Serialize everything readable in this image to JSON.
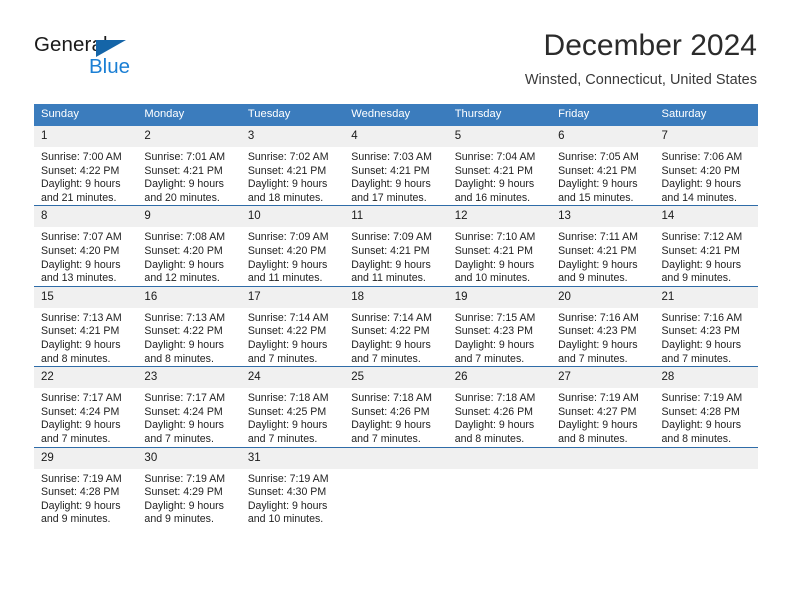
{
  "brand": {
    "name_part1": "General",
    "name_part2": "Blue",
    "accent_color": "#1b7fd4",
    "triangle_color": "#1565a8"
  },
  "header": {
    "title": "December 2024",
    "subtitle": "Winsted, Connecticut, United States"
  },
  "calendar": {
    "header_bg": "#3b7cbd",
    "daynum_bg": "#f0f0f0",
    "row_divider_color": "#2f6ca8",
    "weekday_headers": [
      "Sunday",
      "Monday",
      "Tuesday",
      "Wednesday",
      "Thursday",
      "Friday",
      "Saturday"
    ],
    "weeks": [
      [
        {
          "day": "1",
          "sunrise": "Sunrise: 7:00 AM",
          "sunset": "Sunset: 4:22 PM",
          "daylight1": "Daylight: 9 hours",
          "daylight2": "and 21 minutes."
        },
        {
          "day": "2",
          "sunrise": "Sunrise: 7:01 AM",
          "sunset": "Sunset: 4:21 PM",
          "daylight1": "Daylight: 9 hours",
          "daylight2": "and 20 minutes."
        },
        {
          "day": "3",
          "sunrise": "Sunrise: 7:02 AM",
          "sunset": "Sunset: 4:21 PM",
          "daylight1": "Daylight: 9 hours",
          "daylight2": "and 18 minutes."
        },
        {
          "day": "4",
          "sunrise": "Sunrise: 7:03 AM",
          "sunset": "Sunset: 4:21 PM",
          "daylight1": "Daylight: 9 hours",
          "daylight2": "and 17 minutes."
        },
        {
          "day": "5",
          "sunrise": "Sunrise: 7:04 AM",
          "sunset": "Sunset: 4:21 PM",
          "daylight1": "Daylight: 9 hours",
          "daylight2": "and 16 minutes."
        },
        {
          "day": "6",
          "sunrise": "Sunrise: 7:05 AM",
          "sunset": "Sunset: 4:21 PM",
          "daylight1": "Daylight: 9 hours",
          "daylight2": "and 15 minutes."
        },
        {
          "day": "7",
          "sunrise": "Sunrise: 7:06 AM",
          "sunset": "Sunset: 4:20 PM",
          "daylight1": "Daylight: 9 hours",
          "daylight2": "and 14 minutes."
        }
      ],
      [
        {
          "day": "8",
          "sunrise": "Sunrise: 7:07 AM",
          "sunset": "Sunset: 4:20 PM",
          "daylight1": "Daylight: 9 hours",
          "daylight2": "and 13 minutes."
        },
        {
          "day": "9",
          "sunrise": "Sunrise: 7:08 AM",
          "sunset": "Sunset: 4:20 PM",
          "daylight1": "Daylight: 9 hours",
          "daylight2": "and 12 minutes."
        },
        {
          "day": "10",
          "sunrise": "Sunrise: 7:09 AM",
          "sunset": "Sunset: 4:20 PM",
          "daylight1": "Daylight: 9 hours",
          "daylight2": "and 11 minutes."
        },
        {
          "day": "11",
          "sunrise": "Sunrise: 7:09 AM",
          "sunset": "Sunset: 4:21 PM",
          "daylight1": "Daylight: 9 hours",
          "daylight2": "and 11 minutes."
        },
        {
          "day": "12",
          "sunrise": "Sunrise: 7:10 AM",
          "sunset": "Sunset: 4:21 PM",
          "daylight1": "Daylight: 9 hours",
          "daylight2": "and 10 minutes."
        },
        {
          "day": "13",
          "sunrise": "Sunrise: 7:11 AM",
          "sunset": "Sunset: 4:21 PM",
          "daylight1": "Daylight: 9 hours",
          "daylight2": "and 9 minutes."
        },
        {
          "day": "14",
          "sunrise": "Sunrise: 7:12 AM",
          "sunset": "Sunset: 4:21 PM",
          "daylight1": "Daylight: 9 hours",
          "daylight2": "and 9 minutes."
        }
      ],
      [
        {
          "day": "15",
          "sunrise": "Sunrise: 7:13 AM",
          "sunset": "Sunset: 4:21 PM",
          "daylight1": "Daylight: 9 hours",
          "daylight2": "and 8 minutes."
        },
        {
          "day": "16",
          "sunrise": "Sunrise: 7:13 AM",
          "sunset": "Sunset: 4:22 PM",
          "daylight1": "Daylight: 9 hours",
          "daylight2": "and 8 minutes."
        },
        {
          "day": "17",
          "sunrise": "Sunrise: 7:14 AM",
          "sunset": "Sunset: 4:22 PM",
          "daylight1": "Daylight: 9 hours",
          "daylight2": "and 7 minutes."
        },
        {
          "day": "18",
          "sunrise": "Sunrise: 7:14 AM",
          "sunset": "Sunset: 4:22 PM",
          "daylight1": "Daylight: 9 hours",
          "daylight2": "and 7 minutes."
        },
        {
          "day": "19",
          "sunrise": "Sunrise: 7:15 AM",
          "sunset": "Sunset: 4:23 PM",
          "daylight1": "Daylight: 9 hours",
          "daylight2": "and 7 minutes."
        },
        {
          "day": "20",
          "sunrise": "Sunrise: 7:16 AM",
          "sunset": "Sunset: 4:23 PM",
          "daylight1": "Daylight: 9 hours",
          "daylight2": "and 7 minutes."
        },
        {
          "day": "21",
          "sunrise": "Sunrise: 7:16 AM",
          "sunset": "Sunset: 4:23 PM",
          "daylight1": "Daylight: 9 hours",
          "daylight2": "and 7 minutes."
        }
      ],
      [
        {
          "day": "22",
          "sunrise": "Sunrise: 7:17 AM",
          "sunset": "Sunset: 4:24 PM",
          "daylight1": "Daylight: 9 hours",
          "daylight2": "and 7 minutes."
        },
        {
          "day": "23",
          "sunrise": "Sunrise: 7:17 AM",
          "sunset": "Sunset: 4:24 PM",
          "daylight1": "Daylight: 9 hours",
          "daylight2": "and 7 minutes."
        },
        {
          "day": "24",
          "sunrise": "Sunrise: 7:18 AM",
          "sunset": "Sunset: 4:25 PM",
          "daylight1": "Daylight: 9 hours",
          "daylight2": "and 7 minutes."
        },
        {
          "day": "25",
          "sunrise": "Sunrise: 7:18 AM",
          "sunset": "Sunset: 4:26 PM",
          "daylight1": "Daylight: 9 hours",
          "daylight2": "and 7 minutes."
        },
        {
          "day": "26",
          "sunrise": "Sunrise: 7:18 AM",
          "sunset": "Sunset: 4:26 PM",
          "daylight1": "Daylight: 9 hours",
          "daylight2": "and 8 minutes."
        },
        {
          "day": "27",
          "sunrise": "Sunrise: 7:19 AM",
          "sunset": "Sunset: 4:27 PM",
          "daylight1": "Daylight: 9 hours",
          "daylight2": "and 8 minutes."
        },
        {
          "day": "28",
          "sunrise": "Sunrise: 7:19 AM",
          "sunset": "Sunset: 4:28 PM",
          "daylight1": "Daylight: 9 hours",
          "daylight2": "and 8 minutes."
        }
      ],
      [
        {
          "day": "29",
          "sunrise": "Sunrise: 7:19 AM",
          "sunset": "Sunset: 4:28 PM",
          "daylight1": "Daylight: 9 hours",
          "daylight2": "and 9 minutes."
        },
        {
          "day": "30",
          "sunrise": "Sunrise: 7:19 AM",
          "sunset": "Sunset: 4:29 PM",
          "daylight1": "Daylight: 9 hours",
          "daylight2": "and 9 minutes."
        },
        {
          "day": "31",
          "sunrise": "Sunrise: 7:19 AM",
          "sunset": "Sunset: 4:30 PM",
          "daylight1": "Daylight: 9 hours",
          "daylight2": "and 10 minutes."
        },
        {
          "day": "",
          "sunrise": "",
          "sunset": "",
          "daylight1": "",
          "daylight2": ""
        },
        {
          "day": "",
          "sunrise": "",
          "sunset": "",
          "daylight1": "",
          "daylight2": ""
        },
        {
          "day": "",
          "sunrise": "",
          "sunset": "",
          "daylight1": "",
          "daylight2": ""
        },
        {
          "day": "",
          "sunrise": "",
          "sunset": "",
          "daylight1": "",
          "daylight2": ""
        }
      ]
    ]
  }
}
